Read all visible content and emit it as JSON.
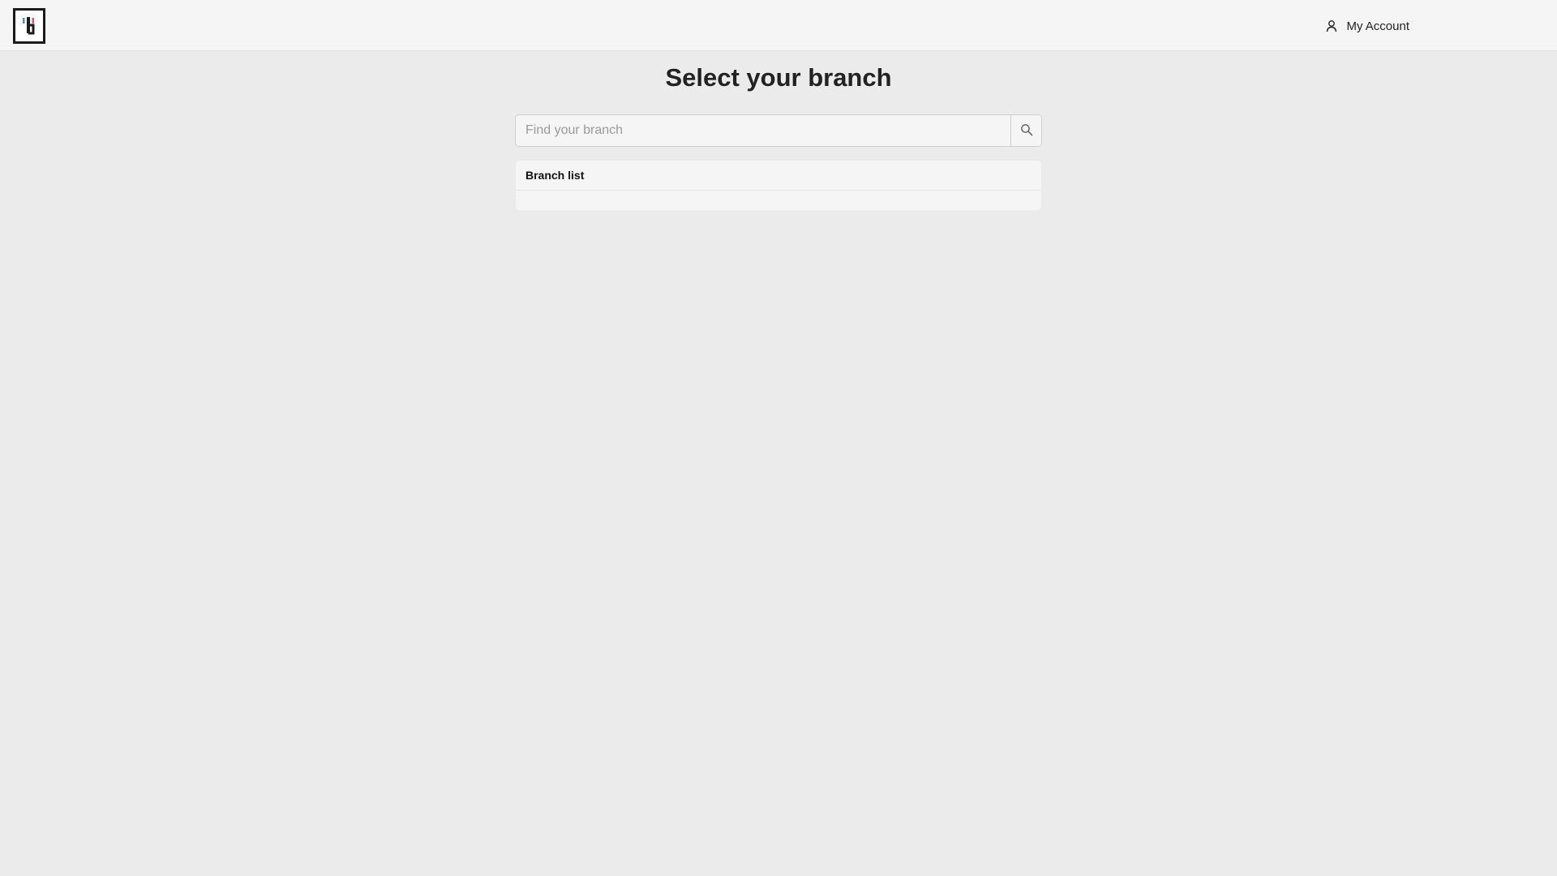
{
  "header": {
    "logo_name": "brand-logo",
    "account_label": "My Account",
    "account_icon": "user-icon"
  },
  "main": {
    "title": "Select your branch",
    "search": {
      "placeholder": "Find your branch",
      "value": "",
      "icon": "search-icon"
    },
    "branch_list": {
      "heading": "Branch list",
      "items": []
    }
  },
  "colors": {
    "background": "#ebebeb",
    "surface": "#f5f5f5",
    "text": "#222222",
    "logo_blue": "#4a8fc7",
    "logo_red": "#d8566b"
  }
}
